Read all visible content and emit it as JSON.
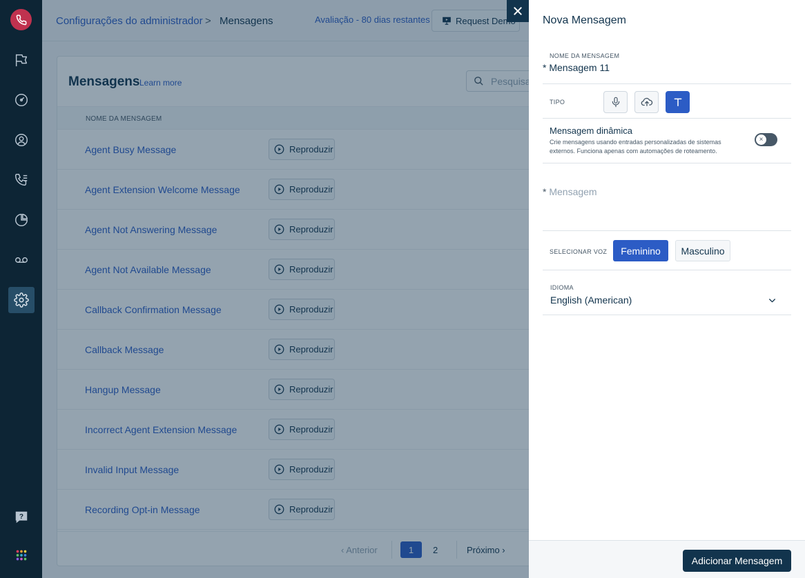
{
  "header": {
    "breadcrumb_link": "Configurações do administrador",
    "breadcrumb_separator": ">",
    "breadcrumb_current": "Mensagens",
    "trial_text": "Avaliação - 80 dias restantes",
    "demo_label": "Request Demo"
  },
  "card": {
    "title": "Mensagens",
    "learn_more": "Learn more",
    "search_placeholder": "Pesquisar",
    "column_header": "NOME DA MENSAGEM",
    "play_label": "Reproduzir",
    "rows": [
      "Agent Busy Message",
      "Agent Extension Welcome Message",
      "Agent Not Answering Message",
      "Agent Not Available Message",
      "Callback Confirmation Message",
      "Callback Message",
      "Hangup Message",
      "Incorrect Agent Extension Message",
      "Invalid Input Message",
      "Recording Opt-in Message"
    ],
    "pagination": {
      "prev": "‹ Anterior",
      "current": "1",
      "page2": "2",
      "next": "Próximo ›"
    }
  },
  "panel": {
    "title": "Nova Mensagem",
    "name_label": "NOME DA MENSAGEM",
    "required_mark": "*",
    "name_value": "Mensagem 11",
    "type_label": "TIPO",
    "dynamic_title": "Mensagem dinâmica",
    "dynamic_desc": "Crie mensagens usando entradas personalizadas de sistemas externos. Funciona apenas com automações de roteamento.",
    "dynamic_enabled": false,
    "message_placeholder": "Mensagem",
    "voice_label": "SELECIONAR VOZ",
    "voice_female": "Feminino",
    "voice_male": "Masculino",
    "selected_voice": "Feminino",
    "language_label": "IDIOMA",
    "language_value": "English (American)",
    "submit_label": "Adicionar Mensagem"
  },
  "colors": {
    "sidebar": "#0d2535",
    "accent": "#2c5cc5",
    "primary_dark": "#12344d",
    "logo": "#c0324f"
  }
}
